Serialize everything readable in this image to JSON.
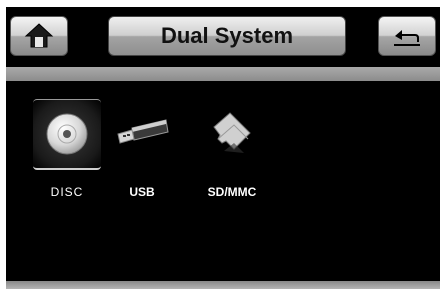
{
  "header": {
    "title": "Dual System",
    "home_icon": "home-icon",
    "back_icon": "back-arrow-icon"
  },
  "sources": {
    "selected": "DISC",
    "items": [
      {
        "label": "DISC",
        "icon": "disc-icon"
      },
      {
        "label": "USB",
        "icon": "usb-icon"
      },
      {
        "label": "SD/MMC",
        "icon": "sd-card-icon"
      }
    ]
  },
  "colors": {
    "background": "#000000",
    "button_light": "#f4f4f4",
    "button_dark": "#8a8a8a",
    "divider": "#a9a9a9"
  }
}
